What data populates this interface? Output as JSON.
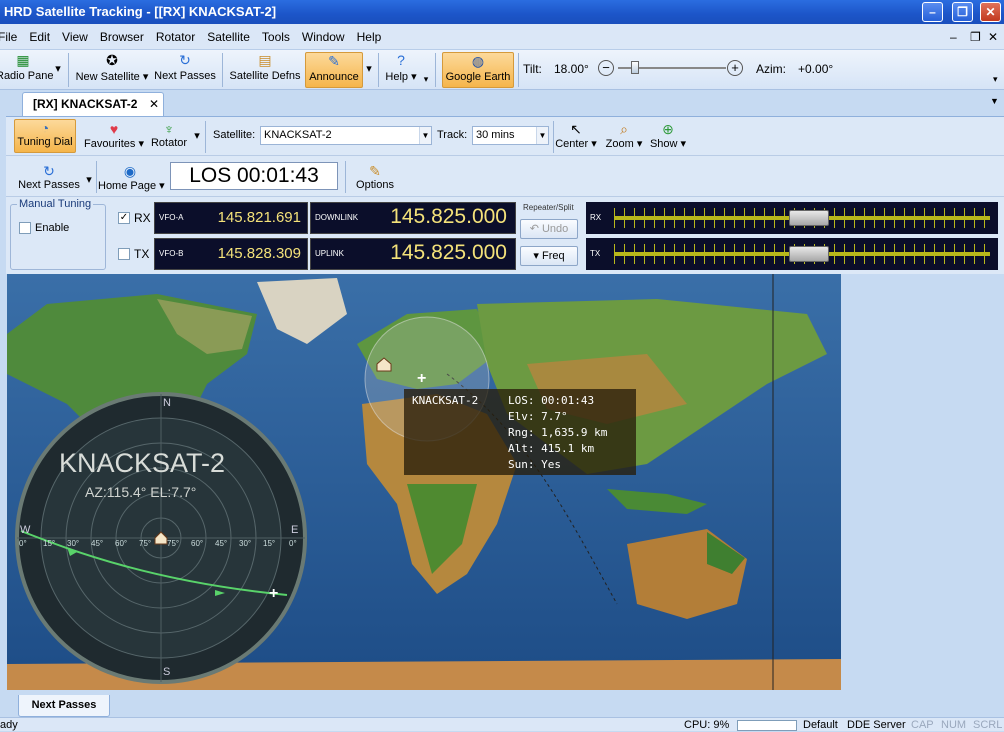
{
  "window": {
    "title": "HRD Satellite Tracking - [[RX]  KNACKSAT-2]"
  },
  "menu": {
    "items": [
      "File",
      "Edit",
      "View",
      "Browser",
      "Rotator",
      "Satellite",
      "Tools",
      "Window",
      "Help"
    ]
  },
  "ribbon": {
    "radio_pane": "Radio Pane",
    "new_satellite": "New Satellite",
    "next_passes": "Next Passes",
    "satellite_defns": "Satellite Defns",
    "announce": "Announce",
    "help": "Help",
    "google_earth": "Google Earth",
    "tilt_label": "Tilt:",
    "tilt_value": "18.00°",
    "tilt_level": 0.13,
    "azim_label": "Azim:",
    "azim_value": "+0.00°"
  },
  "doc_tab": {
    "label": "[RX]  KNACKSAT-2",
    "close": "✕"
  },
  "toolbar": {
    "tuning_dial": "Tuning Dial",
    "favourites": "Favourites",
    "rotator": "Rotator",
    "satellite_label": "Satellite:",
    "satellite_value": "KNACKSAT-2",
    "track_label": "Track:",
    "track_value": "30 mins",
    "center": "Center",
    "zoom": "Zoom",
    "show": "Show",
    "next_passes": "Next Passes",
    "home_page": "Home Page",
    "los": "LOS 00:01:43",
    "options": "Options"
  },
  "manual_tuning": {
    "title": "Manual Tuning",
    "enable": "Enable"
  },
  "radio": {
    "rx": "RX",
    "tx": "TX",
    "vfo_a_label": "VFO-A",
    "vfo_a": "145.821.691",
    "vfo_b_label": "VFO-B",
    "vfo_b": "145.828.309",
    "downlink_label": "DOWNLINK",
    "downlink": "145.825.000",
    "uplink_label": "UPLINK",
    "uplink": "145.825.000",
    "repeater_split": "Repeater/Split",
    "undo": "Undo",
    "freq": "Freq",
    "rx_meter_label": "RX",
    "tx_meter_label": "TX",
    "rx_level": 0.52,
    "tx_level": 0.52
  },
  "tooltip": {
    "name": "KNACKSAT-2",
    "los": "LOS: 00:01:43",
    "elv": "Elv: 7.7°",
    "rng": "Rng: 1,635.9 km",
    "alt": "Alt: 415.1 km",
    "sun": "Sun: Yes"
  },
  "polar": {
    "name": "KNACKSAT-2",
    "azel": "AZ:115.4°  EL:7.7°",
    "n": "N",
    "s": "S",
    "e": "E",
    "w": "W",
    "scale": [
      "0°",
      "15°",
      "30°",
      "45°",
      "60°",
      "75°",
      "75°",
      "60°",
      "45°",
      "30°",
      "15°",
      "0°"
    ]
  },
  "bottom": {
    "next_passes_tab": "Next Passes"
  },
  "status": {
    "ready": "Ready",
    "cpu": "CPU: 9%",
    "default": "Default",
    "dde": "DDE Server",
    "cap": "CAP",
    "num": "NUM",
    "scrl": "SCRL"
  }
}
